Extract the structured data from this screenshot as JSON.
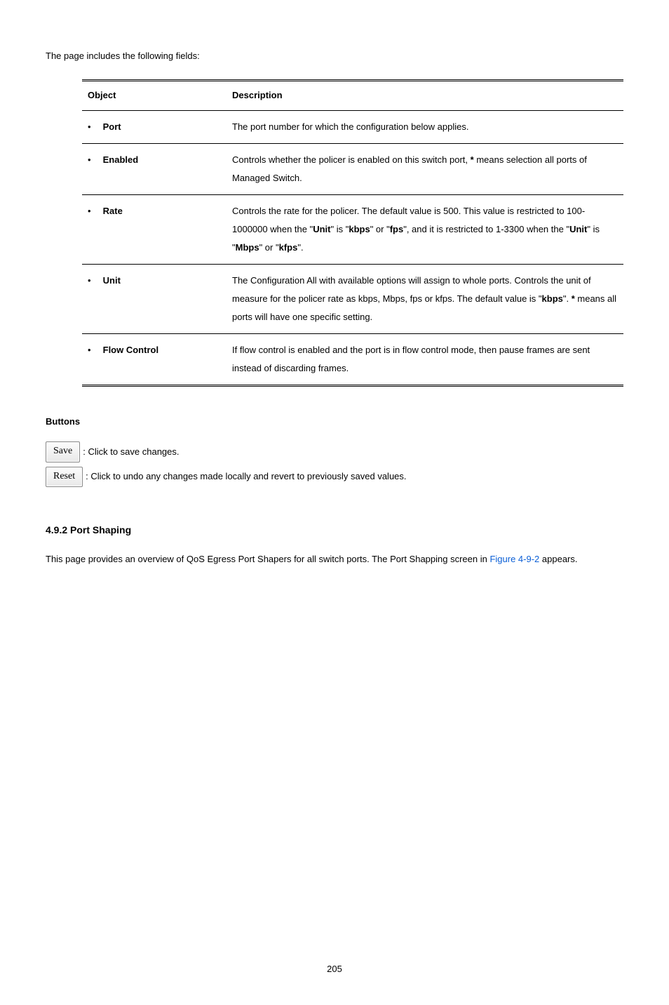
{
  "intro": "The page includes the following fields:",
  "table": {
    "headers": {
      "object": "Object",
      "description": "Description"
    },
    "rows": [
      {
        "object": "Port",
        "desc": "The port number for which the configuration below applies."
      },
      {
        "object": "Enabled",
        "desc_prefix": "Controls whether the policer is enabled on this switch port,",
        "asterisk": "*",
        "desc_suffix": " means selection all ports of Managed Switch."
      },
      {
        "object": "Rate",
        "d1": "Controls the rate for the policer. The default value is 500. This value is restricted to 100-1000000 when the \"",
        "unit_label": "Unit",
        "d2": "\" is \"",
        "kbps": "kbps",
        "d3": "\" or \"",
        "fps": "fps",
        "d4": "\", and it is restricted to 1-3300 when the \"",
        "unit_label2": "Unit",
        "d5": "\" is \"",
        "mbps": "Mbps",
        "d6": "\" or \"",
        "kfps": "kfps",
        "d7": "\"."
      },
      {
        "object": "Unit",
        "u1": "The Configuration All with available options will assign to whole ports. Controls the unit of measure for the policer rate as kbps, Mbps, fps or kfps. The default value is \"",
        "kbps": "kbps",
        "u2": "\". ",
        "asterisk": "*",
        "u3": " means all ports will have one specific setting."
      },
      {
        "object": "Flow Control",
        "desc": "If flow control is enabled and the port is in flow control mode, then pause frames are sent instead of discarding frames."
      }
    ]
  },
  "buttons_heading": "Buttons",
  "buttons": {
    "save": {
      "label": "Save",
      "desc": ": Click to save changes."
    },
    "reset": {
      "label": "Reset",
      "desc": ": Click to undo any changes made locally and revert to previously saved values."
    }
  },
  "section_heading": "4.9.2 Port Shaping",
  "section_para_prefix": "This page provides an overview of QoS Egress Port Shapers for all switch ports. The Port Shapping screen in ",
  "section_link": "Figure 4-9-2",
  "section_para_suffix": " appears.",
  "page_number": "205"
}
